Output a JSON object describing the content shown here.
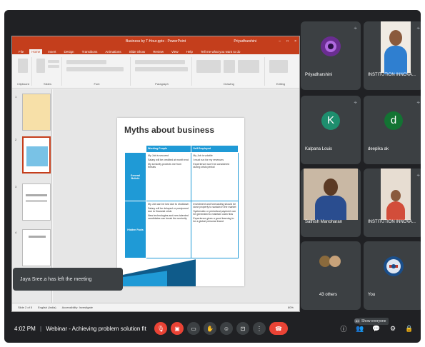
{
  "ppt": {
    "window_title": "Business by T-Hour.pptx - PowerPoint",
    "user": "Priyadharshini",
    "menu": [
      "File",
      "Home",
      "Insert",
      "Design",
      "Transitions",
      "Animations",
      "Slide Show",
      "Review",
      "View",
      "Help",
      "Tell me what you want to do"
    ],
    "active_menu_index": 1,
    "ribbon_groups": [
      "Clipboard",
      "Slides",
      "Font",
      "Paragraph",
      "Drawing",
      "Editing"
    ],
    "status_left": "Slide 2 of 5",
    "status_lang": "English (India)",
    "status_access": "Accessibility: Investigate",
    "status_zoom": "80%",
    "slide": {
      "title": "Myths about business",
      "col_headers": [
        "Working People",
        "Self Employed"
      ],
      "rows": [
        {
          "head": "General Beliefs",
          "working": [
            "My Job is secured",
            "Salary will be credited at month end",
            "My seniority protects me from threats"
          ],
          "self": [
            "My Job is volatile",
            "I must run for my revenues",
            "Experience won't be considered during crisis period"
          ]
        },
        {
          "head": "Hidden Facts",
          "working": [
            "My Job can be lost due to shutdown",
            "Salary will be delayed or postponed due to financial crisis",
            "New technologies and new talented candidates can break the seniority"
          ],
          "self": [
            "Investment and forecasting should be done properly to sustain in the market",
            "Systematic or periodical payment can be generated to maintain cash flow",
            "Experience gives a good learning to be a global personal brand"
          ]
        }
      ]
    },
    "thumb_numbers": [
      "1",
      "2",
      "3",
      "4"
    ]
  },
  "toast": "Jaya Sree.a has left the meeting",
  "participants": [
    {
      "name": "Priyadharshini",
      "type": "image",
      "color": "#6a2d91"
    },
    {
      "name": "INSTITUTION INNOVA...",
      "type": "video"
    },
    {
      "name": "Kalpana Louis",
      "type": "letter",
      "letter": "K",
      "color": "#1e8e6e"
    },
    {
      "name": "deepika ak",
      "type": "letter",
      "letter": "d",
      "color": "#137333"
    },
    {
      "name": "Sathish Manoharan",
      "type": "video"
    },
    {
      "name": "INSTITUTION INNOVA...",
      "type": "video"
    },
    {
      "name": "43 others",
      "type": "others"
    },
    {
      "name": "You",
      "type": "image",
      "color": "#1a4e8a"
    }
  ],
  "tooltip": "Show everyone",
  "people_count": "63",
  "meeting": {
    "time": "4:02 PM",
    "separator": "|",
    "title": "Webinar - Achieving problem solution fit"
  },
  "controls": [
    "mic-off",
    "camera-off",
    "captions",
    "raise-hand",
    "emoji",
    "present",
    "more",
    "leave"
  ],
  "side_controls": [
    "info",
    "people",
    "chat",
    "activities",
    "host-controls"
  ]
}
